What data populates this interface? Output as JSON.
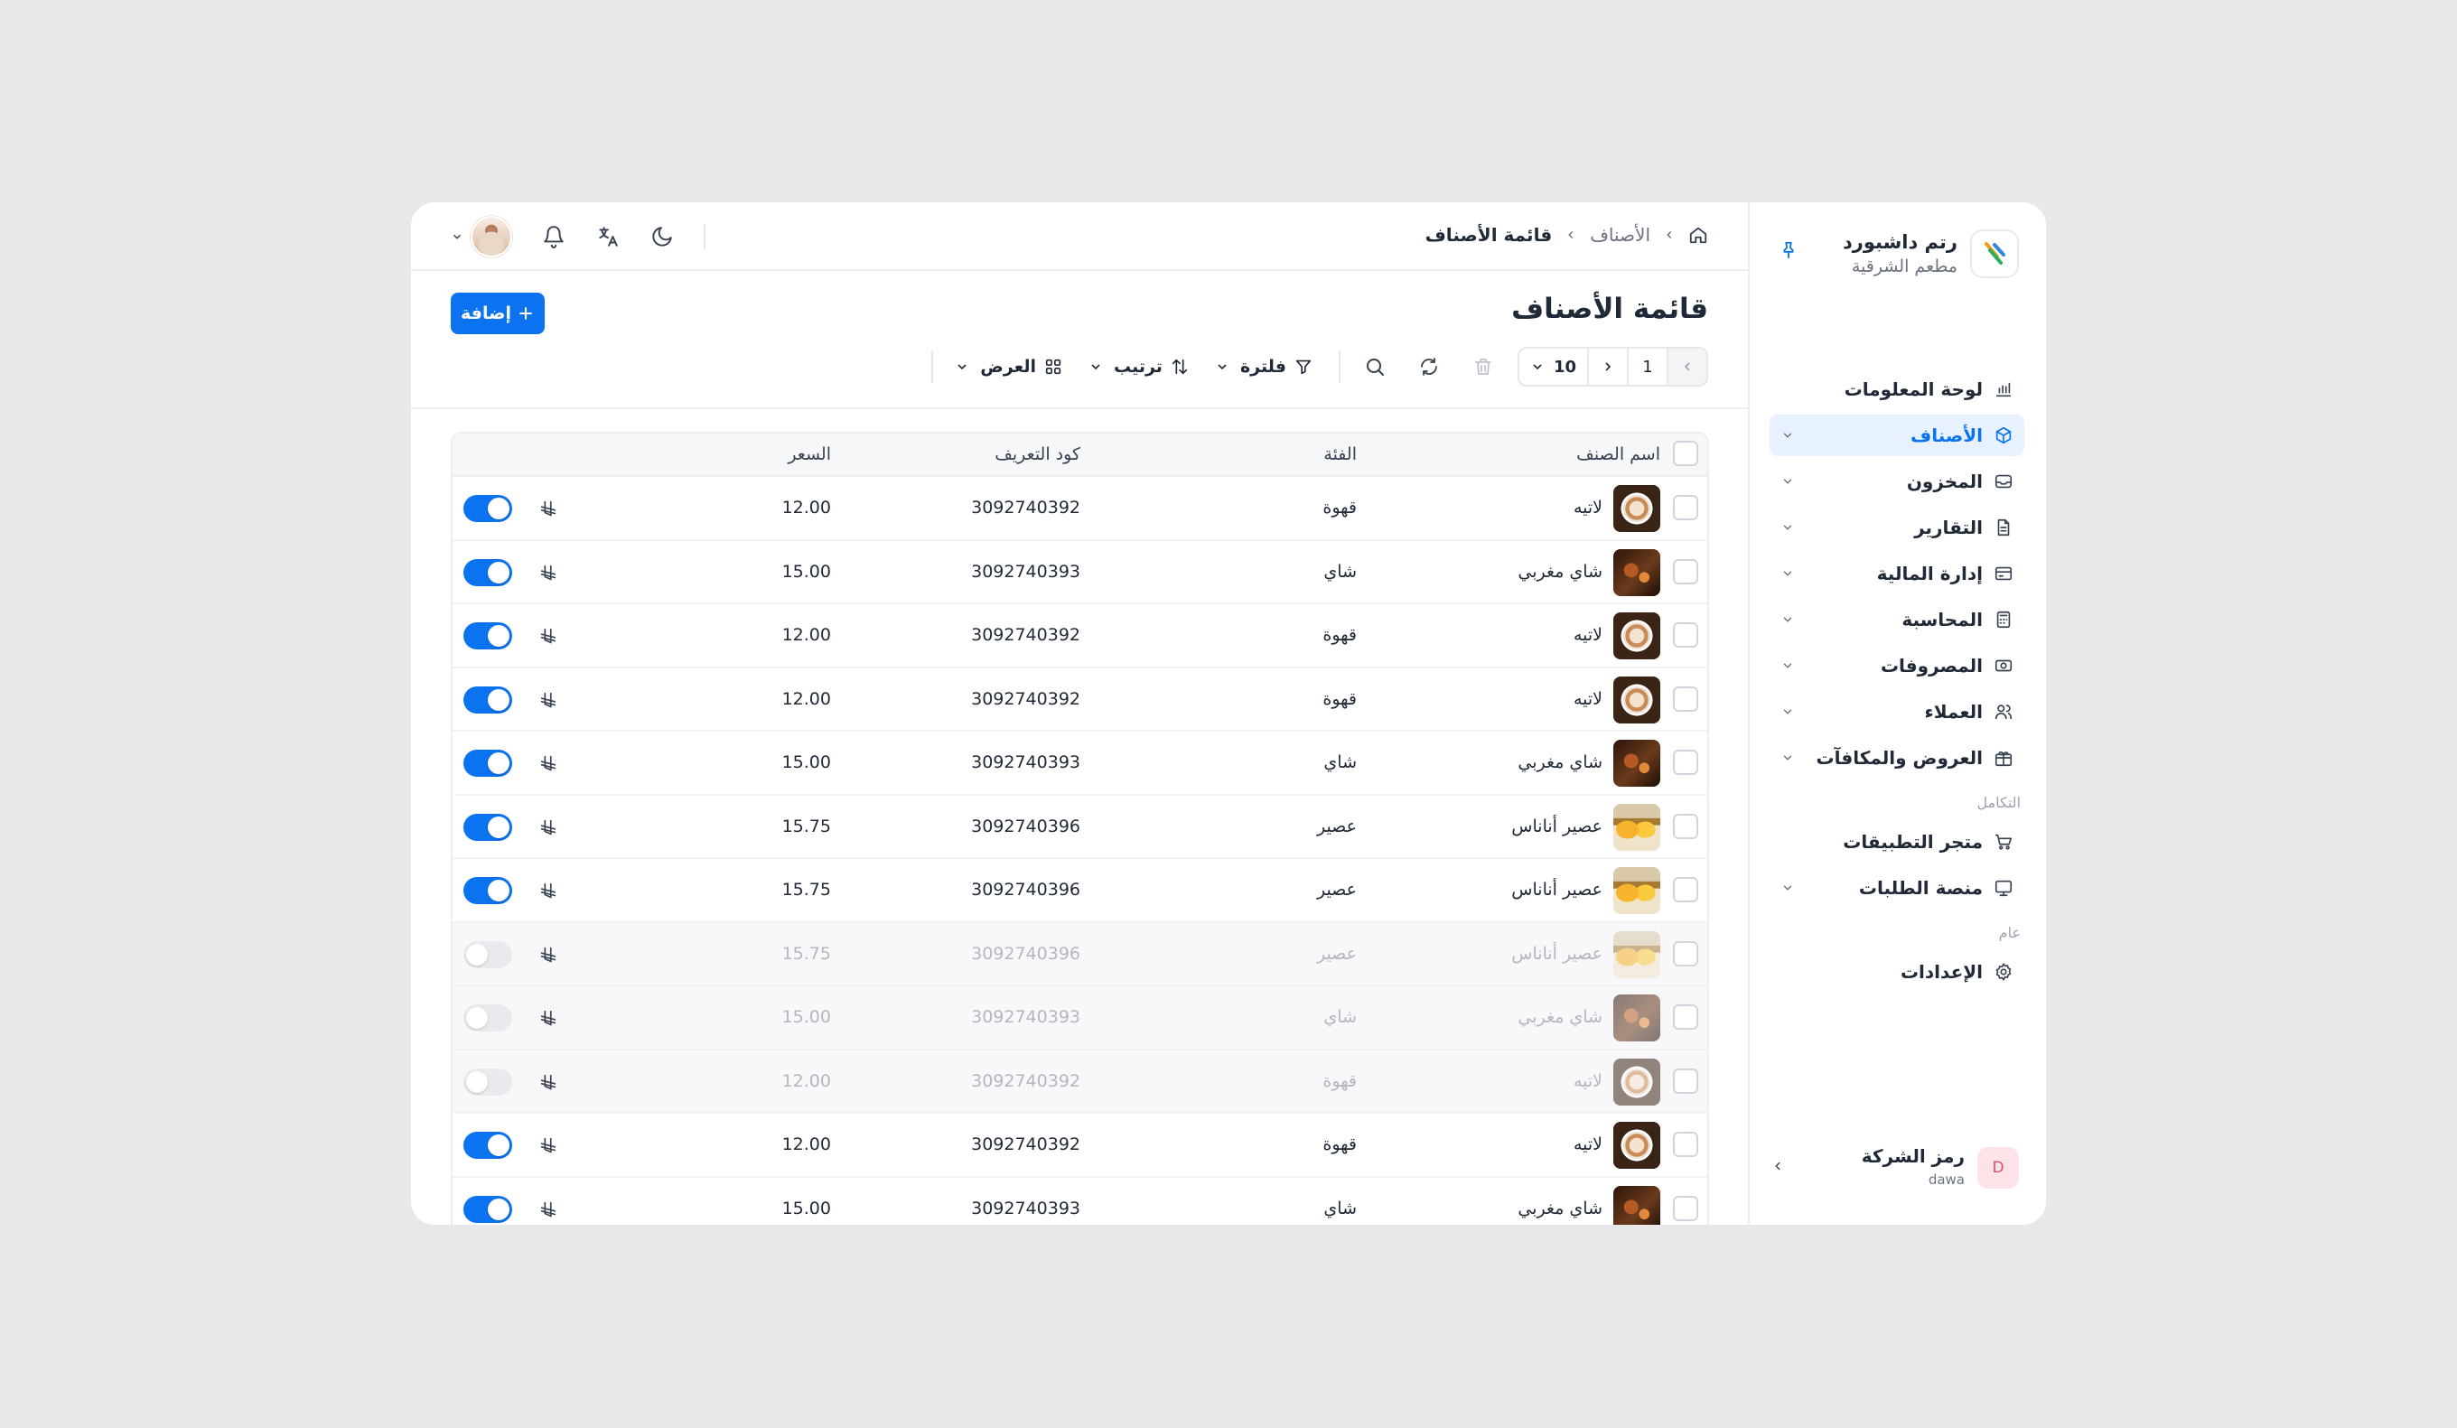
{
  "brand": {
    "name": "رتم داشبورد",
    "subtitle": "مطعم الشرقية"
  },
  "sidebar": {
    "items": [
      {
        "label": "لوحة المعلومات",
        "icon": "chart-icon",
        "chevron": false,
        "active": false
      },
      {
        "label": "الأصناف",
        "icon": "box-icon",
        "chevron": true,
        "active": true
      },
      {
        "label": "المخزون",
        "icon": "inbox-icon",
        "chevron": true,
        "active": false
      },
      {
        "label": "التقارير",
        "icon": "file-icon",
        "chevron": true,
        "active": false
      },
      {
        "label": "إدارة المالية",
        "icon": "card-icon",
        "chevron": true,
        "active": false
      },
      {
        "label": "المحاسبة",
        "icon": "calculator-icon",
        "chevron": true,
        "active": false
      },
      {
        "label": "المصروفات",
        "icon": "cash-icon",
        "chevron": true,
        "active": false
      },
      {
        "label": "العملاء",
        "icon": "users-icon",
        "chevron": true,
        "active": false
      },
      {
        "label": "العروض والمكافآت",
        "icon": "gift-icon",
        "chevron": true,
        "active": false
      }
    ],
    "section_integration": "التكامل",
    "integration_items": [
      {
        "label": "متجر التطبيقات",
        "icon": "cart-icon",
        "chevron": false
      },
      {
        "label": "منصة الطلبات",
        "icon": "monitor-icon",
        "chevron": true
      }
    ],
    "section_general": "عام",
    "general_items": [
      {
        "label": "الإعدادات",
        "icon": "gear-icon",
        "chevron": false
      }
    ]
  },
  "company": {
    "label": "رمز الشركة",
    "code": "dawa",
    "avatar_letter": "D"
  },
  "breadcrumb": {
    "parent": "الأصناف",
    "current": "قائمة الأصناف"
  },
  "page": {
    "title": "قائمة الأصناف",
    "add_label": "إضافة"
  },
  "toolbar": {
    "page_number": "1",
    "page_size": "10",
    "filter_label": "فلترة",
    "sort_label": "ترتيب",
    "view_label": "العرض"
  },
  "table": {
    "columns": {
      "name": "اسم الصنف",
      "category": "الفئة",
      "code": "كود التعريف",
      "price": "السعر"
    },
    "rows": [
      {
        "name": "لاتيه",
        "image": "latte",
        "category": "قهوة",
        "code": "3092740392",
        "price": "12.00",
        "enabled": true
      },
      {
        "name": "شاي مغربي",
        "image": "tea",
        "category": "شاي",
        "code": "3092740393",
        "price": "15.00",
        "enabled": true
      },
      {
        "name": "لاتيه",
        "image": "latte",
        "category": "قهوة",
        "code": "3092740392",
        "price": "12.00",
        "enabled": true
      },
      {
        "name": "لاتيه",
        "image": "latte",
        "category": "قهوة",
        "code": "3092740392",
        "price": "12.00",
        "enabled": true
      },
      {
        "name": "شاي مغربي",
        "image": "tea",
        "category": "شاي",
        "code": "3092740393",
        "price": "15.00",
        "enabled": true
      },
      {
        "name": "عصير أناناس",
        "image": "juice",
        "category": "عصير",
        "code": "3092740396",
        "price": "15.75",
        "enabled": true
      },
      {
        "name": "عصير أناناس",
        "image": "juice",
        "category": "عصير",
        "code": "3092740396",
        "price": "15.75",
        "enabled": true
      },
      {
        "name": "عصير أناناس",
        "image": "juice",
        "category": "عصير",
        "code": "3092740396",
        "price": "15.75",
        "enabled": false
      },
      {
        "name": "شاي مغربي",
        "image": "tea",
        "category": "شاي",
        "code": "3092740393",
        "price": "15.00",
        "enabled": false
      },
      {
        "name": "لاتيه",
        "image": "latte",
        "category": "قهوة",
        "code": "3092740392",
        "price": "12.00",
        "enabled": false
      },
      {
        "name": "لاتيه",
        "image": "latte",
        "category": "قهوة",
        "code": "3092740392",
        "price": "12.00",
        "enabled": true
      },
      {
        "name": "شاي مغربي",
        "image": "tea",
        "category": "شاي",
        "code": "3092740393",
        "price": "15.00",
        "enabled": true
      }
    ]
  },
  "colors": {
    "accent": "#0b73ef",
    "active_bg": "#e8f1ff",
    "background": "#e8e7ea"
  }
}
